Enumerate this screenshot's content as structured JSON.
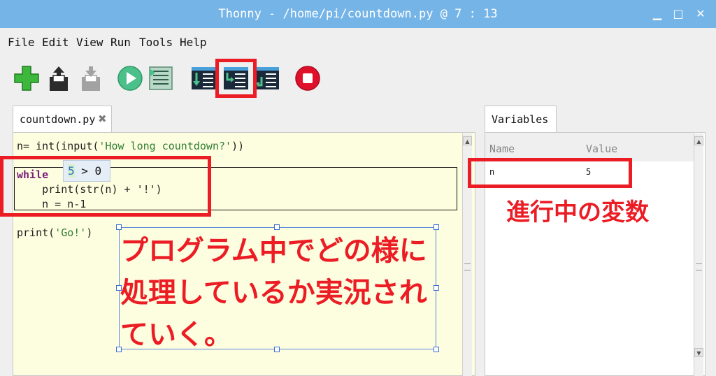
{
  "window": {
    "title": "Thonny  -  /home/pi/countdown.py  @  7 : 13",
    "minimize_glyph": "▁",
    "maximize_glyph": "□",
    "close_glyph": "✕"
  },
  "menu": {
    "items": [
      "File",
      "Edit",
      "View",
      "Run",
      "Tools",
      "Help"
    ]
  },
  "toolbar": {
    "buttons": [
      {
        "icon": "new-file-icon",
        "color": "#3db83d"
      },
      {
        "icon": "open-file-icon",
        "color": "#2b2b2b"
      },
      {
        "icon": "save-file-icon",
        "color": "#9a9a9a"
      },
      {
        "icon": "run-icon",
        "color": "#4cc08a"
      },
      {
        "icon": "debug-icon",
        "color": "#4cc08a"
      },
      {
        "icon": "step-over-icon",
        "color": "#2e8b57"
      },
      {
        "icon": "step-into-icon",
        "color": "#2e8b57"
      },
      {
        "icon": "step-out-icon",
        "color": "#2e8b57"
      },
      {
        "icon": "stop-icon",
        "color": "#e0102a"
      }
    ]
  },
  "editor": {
    "tab_label": "countdown.py",
    "tab_close_glyph": "✖",
    "code": {
      "line1_prefix": "n= int(input(",
      "line1_string": "'How long countdown?'",
      "line1_suffix": "))",
      "line2_keyword": "while",
      "line3": "    print(str(n) + '!')",
      "line4": "    n = n-1",
      "line5_prefix": "print(",
      "line5_string": "'Go!'",
      "line5_suffix": ")"
    },
    "eval_tooltip": {
      "value": "5",
      "rest": " > 0"
    }
  },
  "variables": {
    "tab_label": "Variables",
    "columns": [
      "Name",
      "Value"
    ],
    "rows": [
      {
        "name": "n",
        "value": "5"
      }
    ]
  },
  "annotations": {
    "variables_note": "進行中の変数",
    "main_note_lines": [
      "プログラム中でどの様に",
      "処理しているか実況され",
      "ていく。"
    ],
    "accent_color": "#ec1c24"
  },
  "scroll": {
    "up_glyph": "▲",
    "down_glyph": "▼"
  }
}
